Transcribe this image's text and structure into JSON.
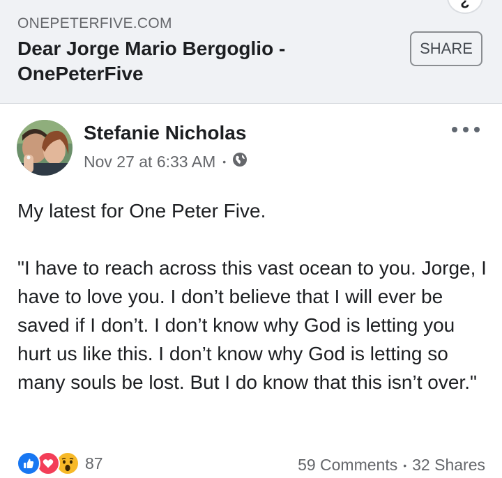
{
  "link_preview": {
    "domain": "ONEPETERFIVE.COM",
    "title": "Dear Jorge Mario Bergoglio - OnePeterFive",
    "share_label": "SHARE",
    "top_button_glyph": "¿"
  },
  "post": {
    "author": "Stefanie Nicholas",
    "timestamp": "Nov 27 at 6:33 AM",
    "separator": "•",
    "privacy_icon": "globe-icon",
    "more_icon": "more-options-icon",
    "paragraphs": [
      "My latest for One Peter Five.",
      "\"I have to reach across this vast ocean to you. Jorge, I have to love you. I don’t believe that I will ever be saved if I don’t. I don’t know why God is letting you hurt us like this. I don’t know why God is letting so many souls be lost. But I do know that this isn’t over.\""
    ]
  },
  "footer": {
    "reactions": [
      "like-icon",
      "love-icon",
      "wow-icon"
    ],
    "reaction_count": "87",
    "comments": "59 Comments",
    "separator": "•",
    "shares": "32 Shares"
  },
  "colors": {
    "card_bg": "#f0f2f5",
    "secondary_text": "#65676b",
    "like_blue": "#1877f2",
    "love_red": "#f33e58",
    "wow_yellow": "#f7b928"
  }
}
